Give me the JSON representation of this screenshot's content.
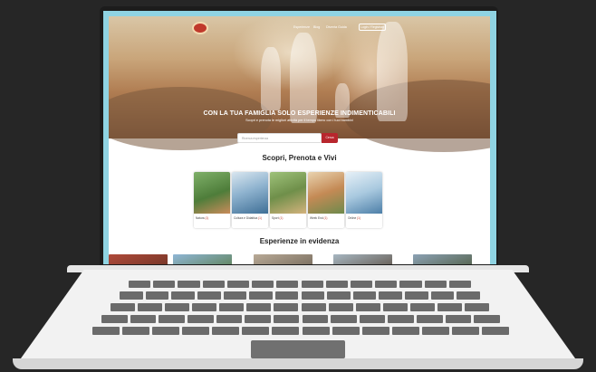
{
  "nav": {
    "items": [
      "Esperienze",
      "Blog",
      "Diventa Guida"
    ],
    "login_label": "Login / Registrati"
  },
  "hero": {
    "headline": "CON LA TUA FAMIGLIA SOLO ESPERIENZE INDIMENTICABILI",
    "subline": "Scopri e prenota le migliori attività per il tempo libero con i tuoi bambini"
  },
  "search": {
    "placeholder": "Ricerca esperienza",
    "button_label": "Cerca"
  },
  "categories": {
    "title": "Scopri, Prenota e Vivi",
    "items": [
      {
        "label": "Natura",
        "count": "(1)"
      },
      {
        "label": "Cultura e Didattica",
        "count": "(1)"
      },
      {
        "label": "Sport",
        "count": "(1)"
      },
      {
        "label": "Week End",
        "count": "(1)"
      },
      {
        "label": "Online",
        "count": "(1)"
      }
    ]
  },
  "featured": {
    "title": "Esperienze in evidenza",
    "badges": [
      "",
      "",
      "",
      "",
      ""
    ]
  },
  "colors": {
    "accent": "#b8262d",
    "frame": "#8fd3e2",
    "background": "#262626"
  }
}
